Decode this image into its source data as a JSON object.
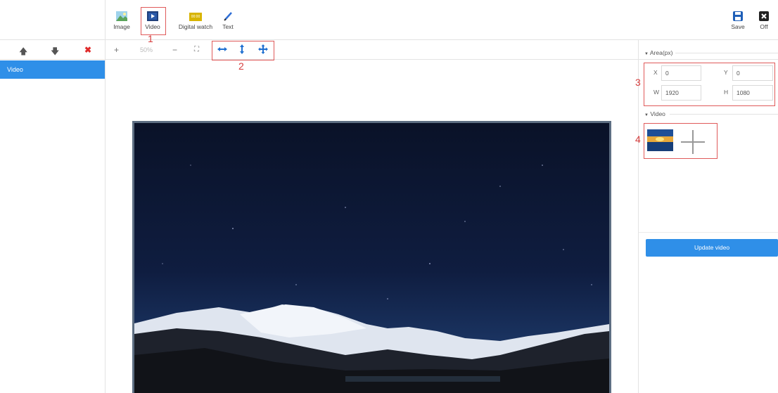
{
  "toolbar": {
    "items": [
      {
        "label": "Image",
        "icon": "image-icon"
      },
      {
        "label": "Video",
        "icon": "video-icon"
      },
      {
        "label": "Digital watch",
        "icon": "digital-watch-icon",
        "display": "00:00"
      },
      {
        "label": "Text",
        "icon": "text-pen-icon"
      }
    ],
    "save_label": "Save",
    "off_label": "Off"
  },
  "annotations": {
    "n1": "1",
    "n2": "2",
    "n3": "3",
    "n4": "4"
  },
  "layer_list": {
    "items": [
      {
        "label": "Video"
      }
    ]
  },
  "canvas_toolbar": {
    "zoom_in": "+",
    "zoom_level": "50%",
    "zoom_out": "−",
    "fit": "⛶"
  },
  "area": {
    "title": "Area(px)",
    "x_label": "X",
    "x_value": "0",
    "y_label": "Y",
    "y_value": "0",
    "w_label": "W",
    "w_value": "1920",
    "h_label": "H",
    "h_value": "1080"
  },
  "video_section": {
    "title": "Video",
    "update_label": "Update video"
  },
  "colors": {
    "accent": "#2f8fe8",
    "annotation_red": "#d63c3c",
    "delete_red": "#e02b2b",
    "sky_dark": "#0c1630"
  }
}
